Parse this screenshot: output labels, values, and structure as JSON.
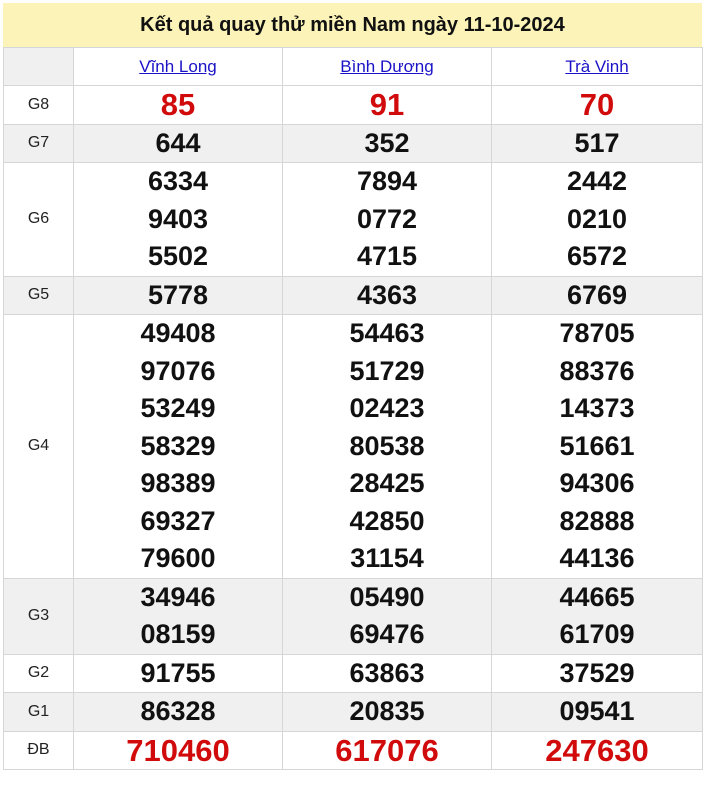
{
  "title": "Kết quả quay thử miền Nam ngày 11-10-2024",
  "provinces": [
    "Vĩnh Long",
    "Bình Dương",
    "Trà Vinh"
  ],
  "prizes": [
    {
      "label": "G8",
      "values": [
        [
          "85"
        ],
        [
          "91"
        ],
        [
          "70"
        ]
      ]
    },
    {
      "label": "G7",
      "values": [
        [
          "644"
        ],
        [
          "352"
        ],
        [
          "517"
        ]
      ]
    },
    {
      "label": "G6",
      "values": [
        [
          "6334",
          "9403",
          "5502"
        ],
        [
          "7894",
          "0772",
          "4715"
        ],
        [
          "2442",
          "0210",
          "6572"
        ]
      ]
    },
    {
      "label": "G5",
      "values": [
        [
          "5778"
        ],
        [
          "4363"
        ],
        [
          "6769"
        ]
      ]
    },
    {
      "label": "G4",
      "values": [
        [
          "49408",
          "97076",
          "53249",
          "58329",
          "98389",
          "69327",
          "79600"
        ],
        [
          "54463",
          "51729",
          "02423",
          "80538",
          "28425",
          "42850",
          "31154"
        ],
        [
          "78705",
          "88376",
          "14373",
          "51661",
          "94306",
          "82888",
          "44136"
        ]
      ]
    },
    {
      "label": "G3",
      "values": [
        [
          "34946",
          "08159"
        ],
        [
          "05490",
          "69476"
        ],
        [
          "44665",
          "61709"
        ]
      ]
    },
    {
      "label": "G2",
      "values": [
        [
          "91755"
        ],
        [
          "63863"
        ],
        [
          "37529"
        ]
      ]
    },
    {
      "label": "G1",
      "values": [
        [
          "86328"
        ],
        [
          "20835"
        ],
        [
          "09541"
        ]
      ]
    },
    {
      "label": "ĐB",
      "values": [
        [
          "710460"
        ],
        [
          "617076"
        ],
        [
          "247630"
        ]
      ]
    }
  ],
  "colors": {
    "title_bg": "#fbf3b8",
    "link": "#1a12c7",
    "highlight": "#d10b0b",
    "alt_row": "#f0f0f0"
  }
}
